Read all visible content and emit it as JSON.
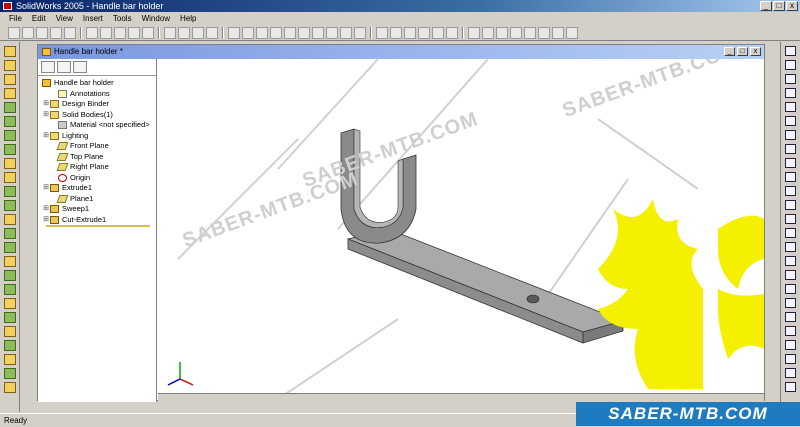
{
  "window": {
    "title": "SolidWorks 2005 - Handle bar holder",
    "controls": [
      "_",
      "□",
      "x"
    ]
  },
  "menu": [
    "File",
    "Edit",
    "View",
    "Insert",
    "Tools",
    "Window",
    "Help"
  ],
  "document": {
    "title": "Handle bar holder *",
    "controls": [
      "_",
      "□",
      "x"
    ]
  },
  "feature_tree": {
    "root": "Handle bar holder",
    "items": [
      {
        "label": "Annotations",
        "expandable": false
      },
      {
        "label": "Design Binder",
        "expandable": true
      },
      {
        "label": "Solid Bodies(1)",
        "expandable": true
      },
      {
        "label": "Material <not specified>",
        "expandable": false
      },
      {
        "label": "Lighting",
        "expandable": true
      },
      {
        "label": "Front Plane",
        "expandable": false
      },
      {
        "label": "Top Plane",
        "expandable": false
      },
      {
        "label": "Right Plane",
        "expandable": false
      },
      {
        "label": "Origin",
        "expandable": false
      },
      {
        "label": "Extrude1",
        "expandable": true
      },
      {
        "label": "Plane1",
        "expandable": false
      },
      {
        "label": "Sweep1",
        "expandable": true
      },
      {
        "label": "Cut-Extrude1",
        "expandable": true
      }
    ]
  },
  "status": "Ready",
  "watermark_text": "SABER-MTB.COM",
  "badge_text": "SABER-MTB.COM",
  "colors": {
    "title_active": "#0a246a",
    "doc_title": "#7a96df",
    "model_gray": "#9a9a9a",
    "logo_yellow": "#f5f000",
    "badge_blue": "#1f7bbf"
  }
}
